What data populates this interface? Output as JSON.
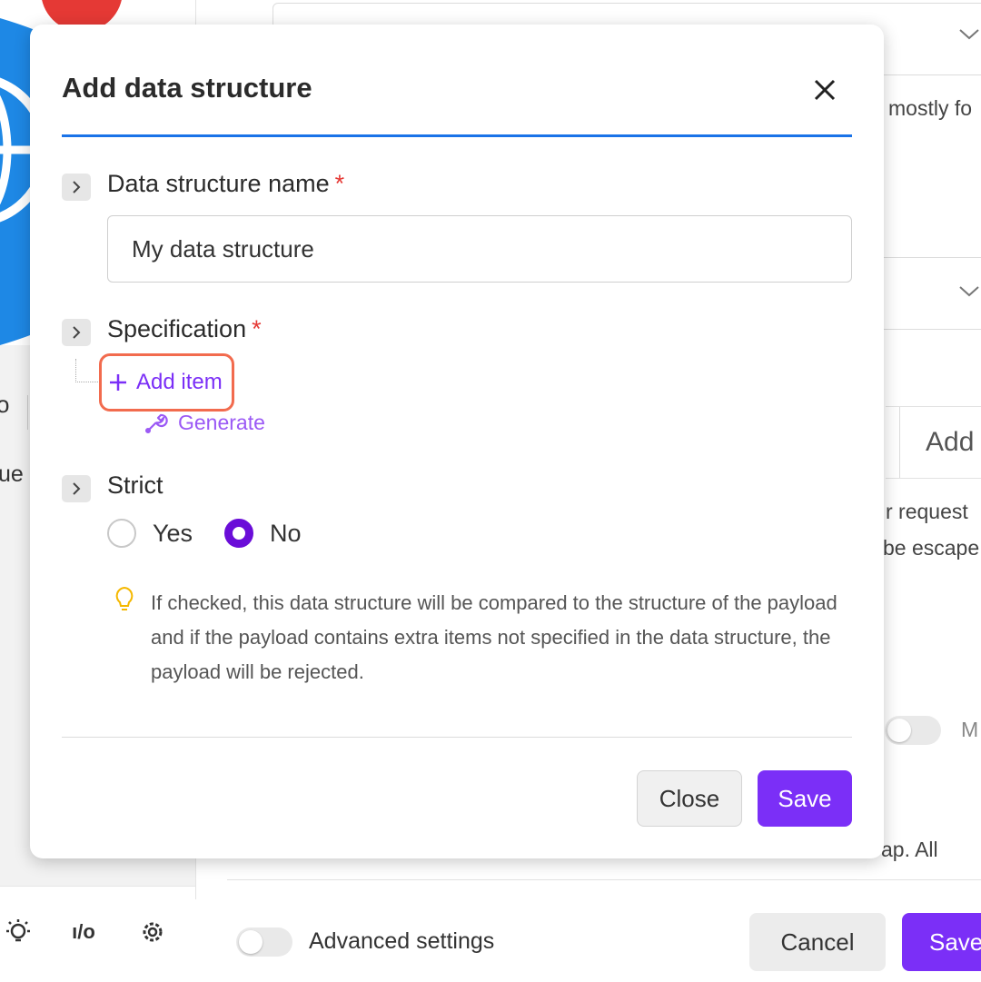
{
  "background": {
    "edge_texts": [
      "o",
      "ue"
    ],
    "right_snippets": {
      "mostly": "mostly fo",
      "request": "r request",
      "escape": "be escape",
      "toggle_label": "M",
      "map_line": "ap. All"
    },
    "add_button_label": "Add",
    "bottom_bar": {
      "advanced_settings_label": "Advanced settings",
      "io_label": "ı/o",
      "cancel_label": "Cancel",
      "save_label": "Save"
    }
  },
  "modal": {
    "title": "Add data structure",
    "name_field": {
      "label": "Data structure name",
      "required_mark": "*",
      "value": "My data structure"
    },
    "specification": {
      "label": "Specification",
      "required_mark": "*",
      "add_item_label": "Add item",
      "generate_label": "Generate"
    },
    "strict": {
      "label": "Strict",
      "options": [
        "Yes",
        "No"
      ],
      "selected": "No",
      "hint": "If checked, this data structure will be compared to the structure of the payload and if the payload contains extra items not specified in the data structure, the payload will be rejected."
    },
    "footer": {
      "close_label": "Close",
      "save_label": "Save"
    }
  },
  "colors": {
    "accent_purple": "#7b2ff7",
    "title_underline_blue": "#1a73e8",
    "highlight_orange": "#f26b4e",
    "required_red": "#e53935"
  }
}
